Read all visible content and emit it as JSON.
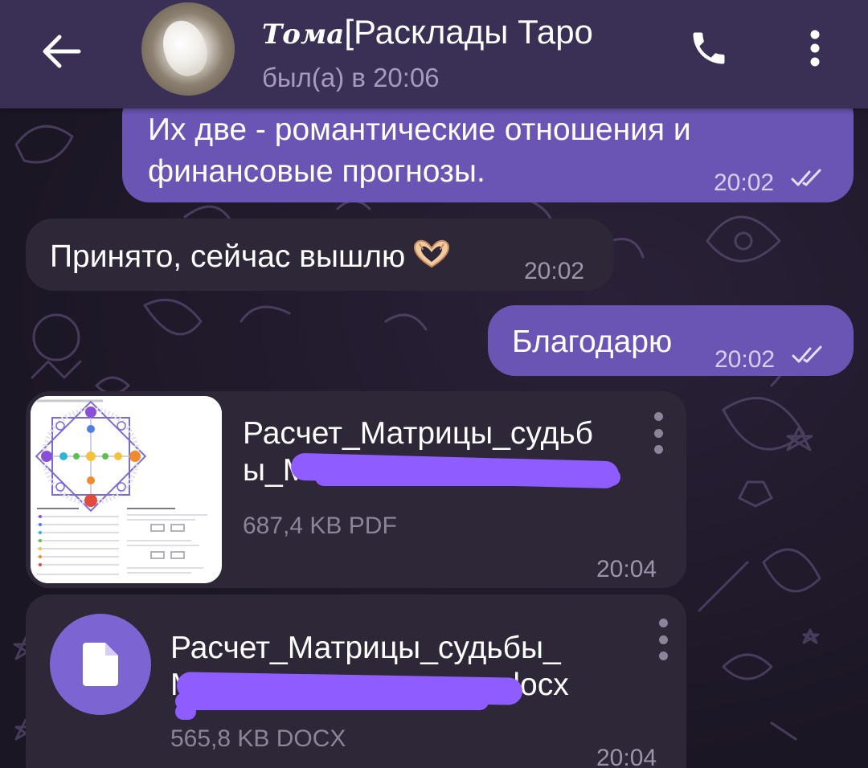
{
  "header": {
    "contact_name_script": "Тома",
    "contact_name_rest": "[Расклады Таро",
    "status": "был(а) в 20:06"
  },
  "messages": [
    {
      "direction": "outgoing",
      "text_line1": "Их две - романтические отношения и",
      "text_line2": "финансовые прогнозы.",
      "time": "20:02",
      "read": true
    },
    {
      "direction": "incoming",
      "text": "Принято, сейчас вышлю",
      "emoji": "heart-hands",
      "time": "20:02"
    },
    {
      "direction": "outgoing",
      "text": "Благодарю",
      "time": "20:02",
      "read": true
    }
  ],
  "files": [
    {
      "name_line1": "Расчет_Матрицы_судьб",
      "name_line2": "ы_М",
      "size": "687,4 KB PDF",
      "time": "20:04",
      "type": "pdf",
      "name_partially_hidden": true
    },
    {
      "name_line1": "Расчет_Матрицы_судьбы_",
      "name_line2_start": "M",
      "name_line2_end": ".docx",
      "size": "565,8 KB DOCX",
      "time": "20:04",
      "type": "docx",
      "name_partially_hidden": true
    }
  ],
  "colors": {
    "header_bg": "#3a2f55",
    "outgoing_bubble": "#6a55b4",
    "incoming_bubble": "#2d2738",
    "doc_icon_bg": "#7c64d3",
    "redaction": "#8e5cff"
  },
  "icons": [
    "arrow-left-icon",
    "phone-icon",
    "more-vert-icon",
    "double-check-icon",
    "document-icon",
    "heart-hands-emoji"
  ]
}
